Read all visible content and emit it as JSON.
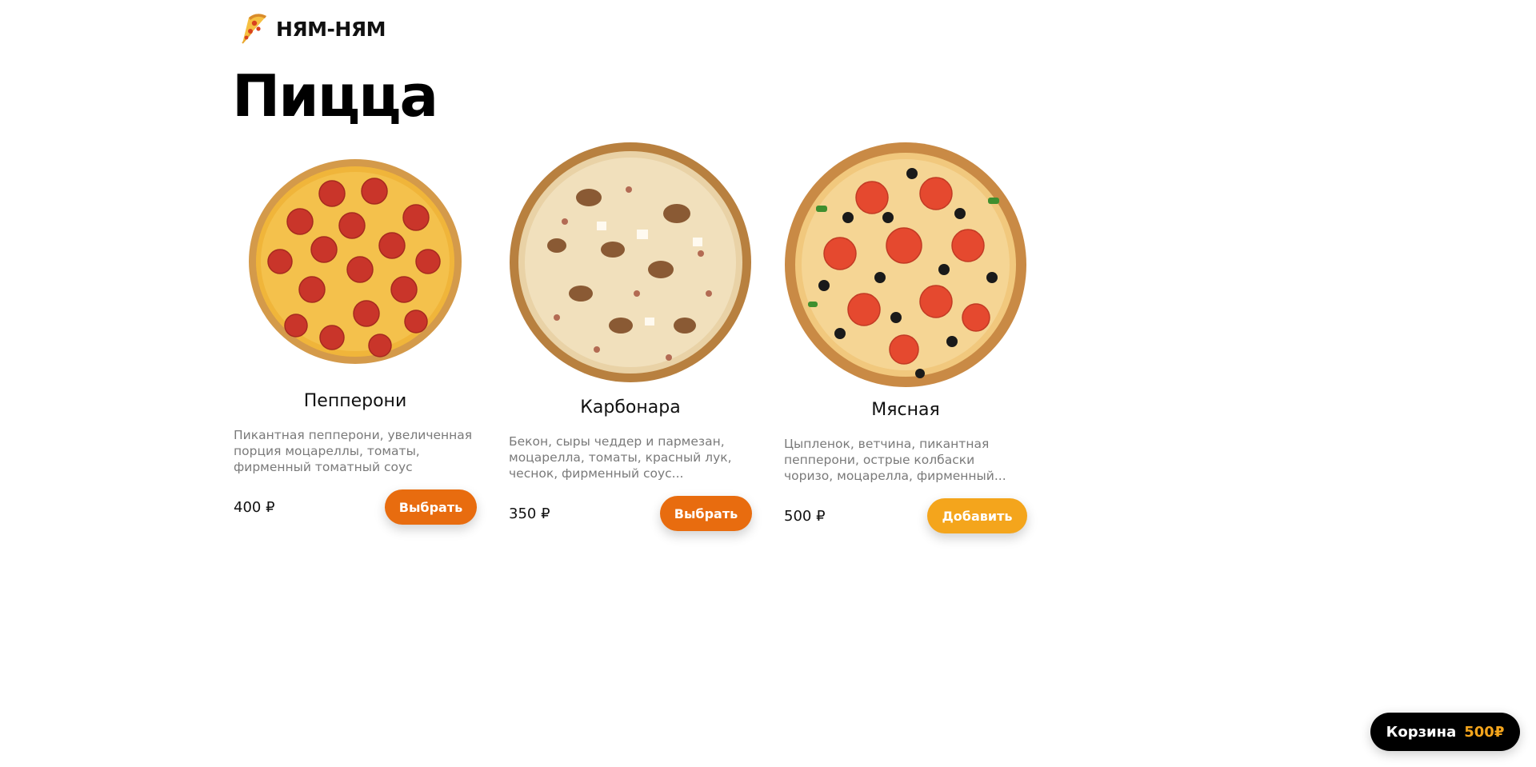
{
  "header": {
    "logo_icon": "pizza-slice-icon",
    "brand_name": "НЯМ-НЯМ"
  },
  "page": {
    "title": "Пицца"
  },
  "colors": {
    "primary_orange": "#e86c0f",
    "accent_yellow": "#f4a51c",
    "cart_background": "#000000",
    "description_gray": "#7a7a7a"
  },
  "products": [
    {
      "name": "Пепперони",
      "description": "Пикантная пепперони, увеличенная порция моцареллы, томаты, фирменный томатный соус",
      "price": "400 ₽",
      "button_label": "Выбрать",
      "image_icon": "pepperoni-pizza-image"
    },
    {
      "name": "Карбонара",
      "description": "Бекон, сыры чеддер и пармезан, моцарелла, томаты, красный лук, чеснок, фирменный соус...",
      "price": "350 ₽",
      "button_label": "Выбрать",
      "image_icon": "carbonara-pizza-image"
    },
    {
      "name": "Мясная",
      "description": "Цыпленок, ветчина, пикантная пепперони, острые колбаски чоризо, моцарелла, фирменный...",
      "price": "500 ₽",
      "button_label": "Добавить",
      "image_icon": "meat-pizza-image"
    }
  ],
  "cart": {
    "label": "Корзина",
    "total": "500₽"
  }
}
